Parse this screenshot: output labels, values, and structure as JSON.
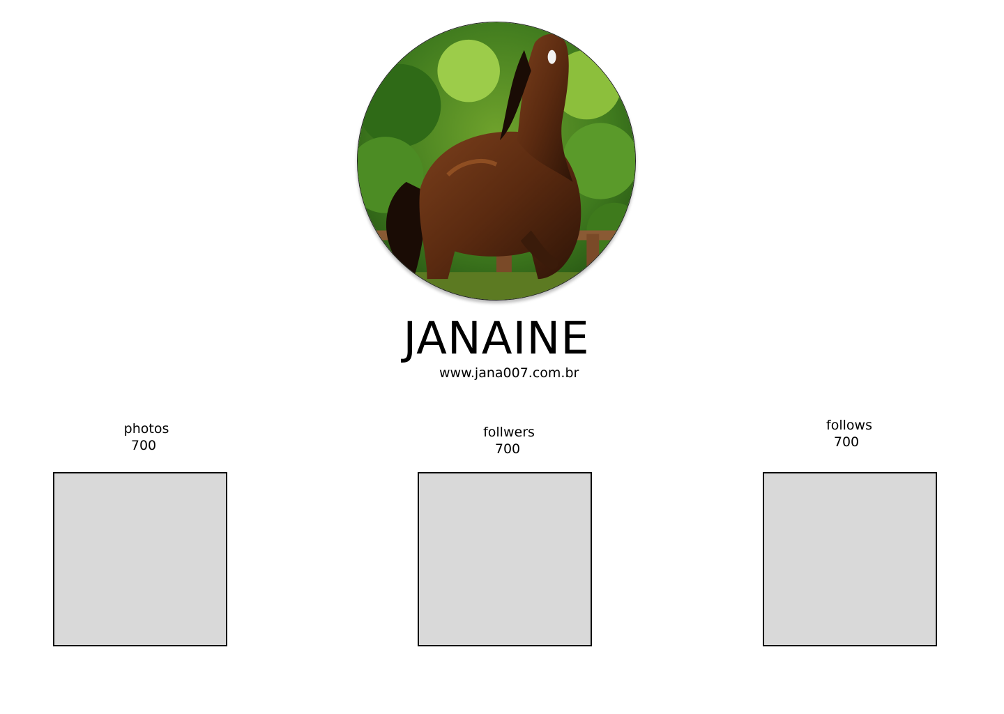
{
  "profile": {
    "avatar_icon": "horse-photo",
    "name": "JANAINE",
    "website": "www.jana007.com.br"
  },
  "stats": {
    "photos": {
      "label": "photos",
      "value": "700"
    },
    "followers": {
      "label": "follwers",
      "value": "700"
    },
    "follows": {
      "label": "follows",
      "value": "700"
    }
  },
  "colors": {
    "placeholder_fill": "#d9d9d9",
    "placeholder_border": "#000000",
    "background": "#ffffff",
    "text": "#000000"
  }
}
